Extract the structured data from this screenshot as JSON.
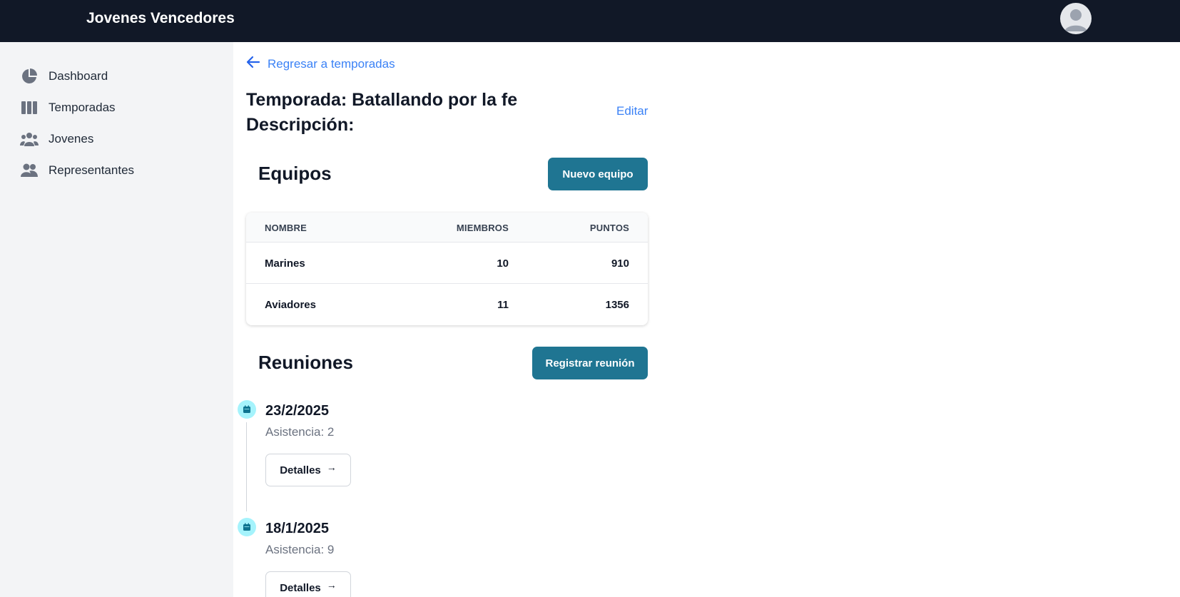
{
  "header": {
    "brand": "Jovenes Vencedores",
    "avatar_icon": "user-avatar-icon"
  },
  "sidebar": {
    "items": [
      {
        "label": "Dashboard",
        "icon": "pie-chart-icon"
      },
      {
        "label": "Temporadas",
        "icon": "columns-icon"
      },
      {
        "label": "Jovenes",
        "icon": "user-group-icon"
      },
      {
        "label": "Representantes",
        "icon": "users-icon"
      }
    ]
  },
  "main": {
    "back_label": "Regresar a temporadas",
    "season_title": "Temporada: Batallando por la fe",
    "description_label": "Descripción:",
    "edit_label": "Editar",
    "teams": {
      "title": "Equipos",
      "new_button": "Nuevo equipo",
      "columns": [
        "NOMBRE",
        "MIEMBROS",
        "PUNTOS"
      ],
      "rows": [
        {
          "name": "Marines",
          "members": "10",
          "points": "910"
        },
        {
          "name": "Aviadores",
          "members": "11",
          "points": "1356"
        }
      ]
    },
    "meetings": {
      "title": "Reuniones",
      "register_button": "Registrar reunión",
      "items": [
        {
          "date": "23/2/2025",
          "attendance": "Asistencia: 2",
          "details_label": "Detalles"
        },
        {
          "date": "18/1/2025",
          "attendance": "Asistencia: 9",
          "details_label": "Detalles"
        }
      ]
    }
  },
  "colors": {
    "topbar": "#111827",
    "sidebar": "#f3f4f6",
    "primary_button": "#1f7592",
    "link": "#3b82f6",
    "timeline_dot": "#a5f3fc"
  }
}
